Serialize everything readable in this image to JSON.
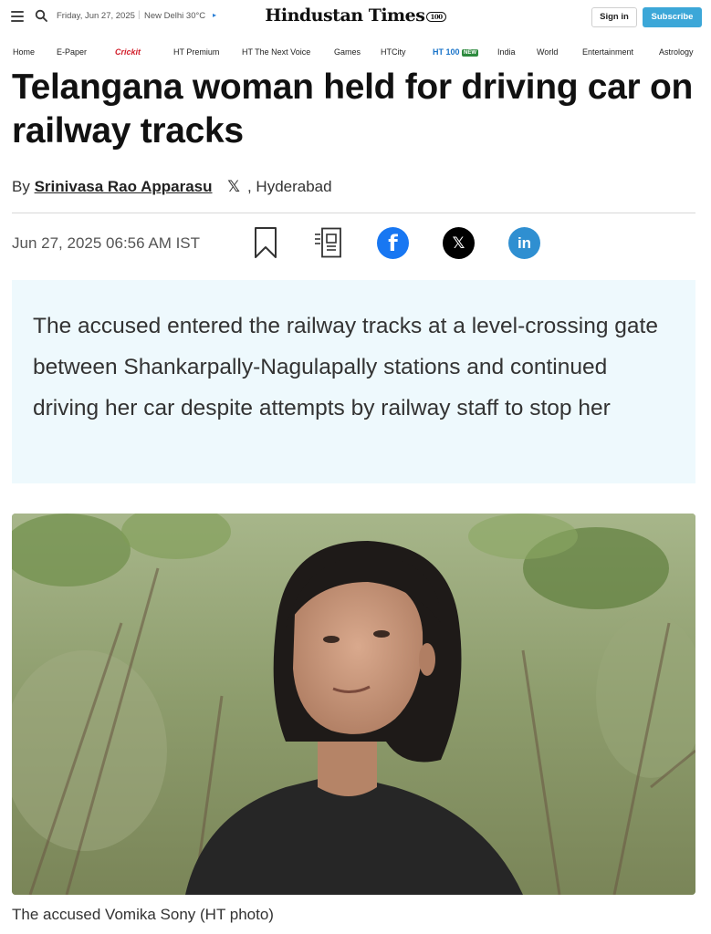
{
  "topbar": {
    "date": "Friday, Jun 27, 2025",
    "separator": "|",
    "weather": "New Delhi 30°C",
    "logo": "Hindustan Times",
    "logo_badge": "100",
    "signin_label": "Sign in",
    "subscribe_label": "Subscribe",
    "subscribe_color": "#3ca7d8"
  },
  "nav": {
    "items": [
      "Home",
      "E-Paper",
      "Crickit",
      "HT Premium",
      "HT The Next Voice",
      "Games",
      "HTCity",
      "HT 100",
      "NEW",
      "India",
      "World",
      "Entertainment",
      "Astrology"
    ]
  },
  "article": {
    "headline": "Telangana woman held for driving car on railway tracks",
    "by": "By",
    "author": "Srinivasa Rao Apparasu",
    "location": ", Hyderabad",
    "timestamp": "Jun 27, 2025 06:56 AM IST",
    "summary": "The accused entered the railway tracks at a level-crossing gate between Shankarpally-Nagulapally stations and continued driving her car despite attempts by railway staff to stop her",
    "photo_caption": "The accused Vomika Sony (HT photo)"
  },
  "icons": {
    "share": [
      "facebook-icon",
      "x-icon",
      "linkedin-icon"
    ],
    "facebook_color": "#1877f2",
    "linkedin_color": "#2f8fd1",
    "summary_bg": "#eef9fd"
  }
}
